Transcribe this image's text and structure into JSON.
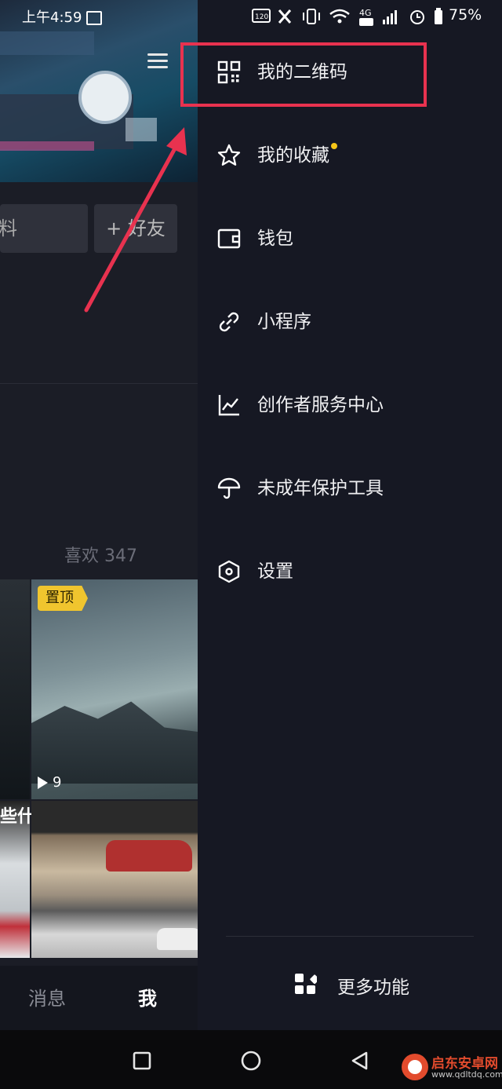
{
  "status_bar": {
    "time": "上午4:59",
    "battery": "75%",
    "network": "4G"
  },
  "profile_page": {
    "edit_button": "料",
    "add_friend_button": "+ 好友",
    "likes_tab": "喜欢 347",
    "pinned_badge": "置顶",
    "play_count": "9",
    "video_caption_fragment": "些什",
    "tabs": {
      "messages": "消息",
      "me": "我"
    }
  },
  "drawer": {
    "items": [
      {
        "label": "我的二维码",
        "icon": "qr-code-icon"
      },
      {
        "label": "我的收藏",
        "icon": "star-icon"
      },
      {
        "label": "钱包",
        "icon": "wallet-icon"
      },
      {
        "label": "小程序",
        "icon": "link-icon"
      },
      {
        "label": "创作者服务中心",
        "icon": "chart-icon"
      },
      {
        "label": "未成年保护工具",
        "icon": "umbrella-icon"
      },
      {
        "label": "设置",
        "icon": "hexagon-settings-icon"
      }
    ],
    "more_functions": "更多功能"
  },
  "annotation": {
    "highlight_color": "#e8324f"
  },
  "watermark": {
    "title": "启东安卓网",
    "url": "www.qdltdq.com"
  }
}
